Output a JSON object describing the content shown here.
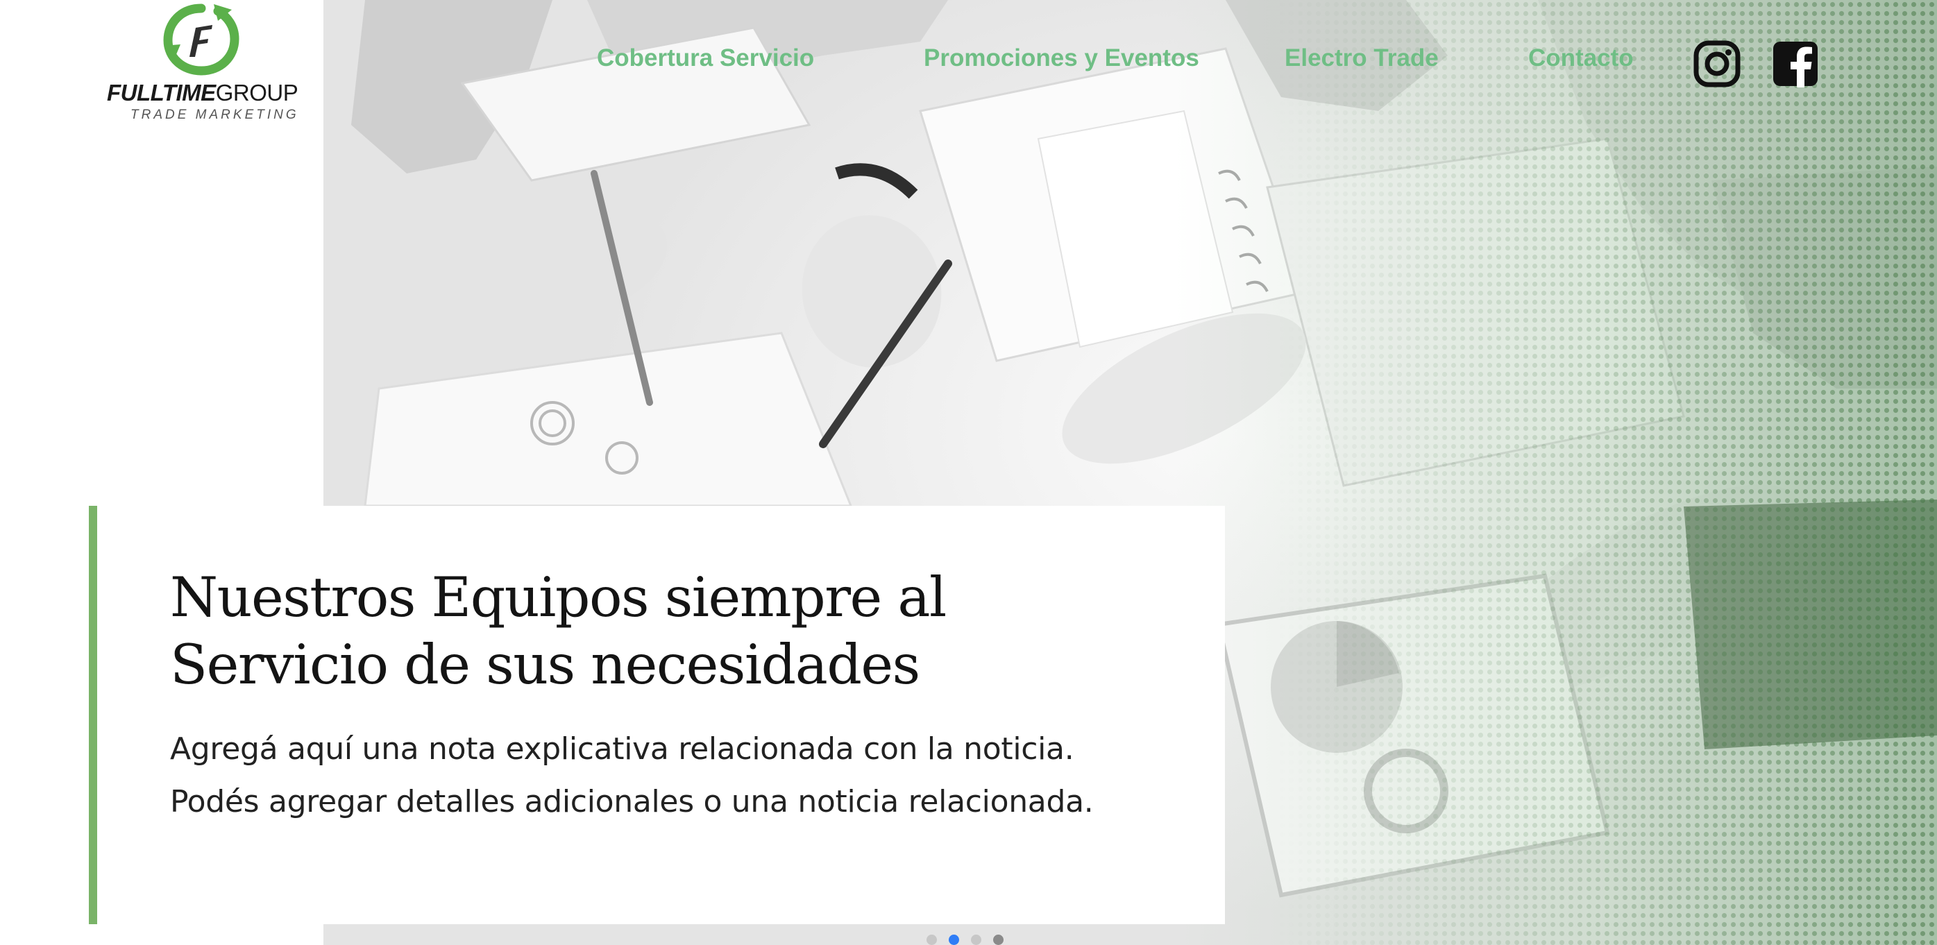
{
  "brand": {
    "name_bold": "FULLTIME",
    "name_light": "GROUP",
    "tagline": "TRADE MARKETING",
    "logo_icon": "fulltime-arrows-logo-icon",
    "accent_color": "#6fbe85",
    "bar_color": "#7ab368"
  },
  "nav": {
    "items": [
      {
        "label": "Cobertura Servicio"
      },
      {
        "label": "Promociones y Eventos"
      },
      {
        "label": "Electro Trade"
      },
      {
        "label": "Contacto"
      }
    ]
  },
  "social": {
    "instagram_icon": "instagram-icon",
    "facebook_icon": "facebook-icon"
  },
  "hero": {
    "title_line1": "Nuestros Equipos  siempre al",
    "title_line2": "Servicio de sus necesidades",
    "text_line1": "Agregá aquí una nota explicativa relacionada con la noticia.",
    "text_line2": "Podés agregar detalles adicionales o una noticia relacionada.",
    "background_image": "office-meeting-documents-photo"
  },
  "carousel": {
    "slide_count": 4,
    "active_index": 1
  }
}
